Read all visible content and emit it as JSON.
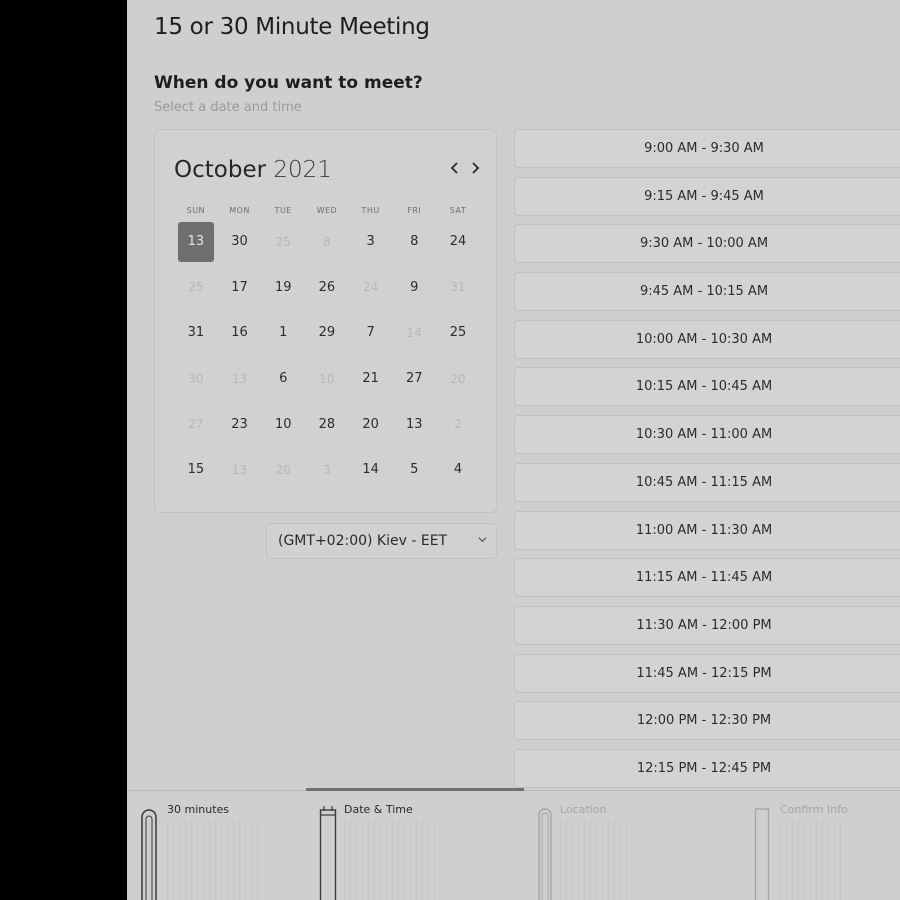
{
  "page": {
    "title": "15 or 30 Minute Meeting",
    "question": "When do you want to meet?",
    "hint": "Select a date and time"
  },
  "calendar": {
    "month": "October",
    "year": "2021",
    "prev_icon": "chevron-left-icon",
    "next_icon": "chevron-right-icon",
    "weekdays": [
      "SUN",
      "MON",
      "TUE",
      "WED",
      "THU",
      "FRI",
      "SAT"
    ],
    "weeks": [
      [
        {
          "d": "13",
          "state": "selected"
        },
        {
          "d": "30",
          "state": "available"
        },
        {
          "d": "25",
          "state": "disabled"
        },
        {
          "d": "8",
          "state": "disabled"
        },
        {
          "d": "3",
          "state": "available"
        },
        {
          "d": "8",
          "state": "available"
        },
        {
          "d": "24",
          "state": "available"
        }
      ],
      [
        {
          "d": "25",
          "state": "disabled"
        },
        {
          "d": "17",
          "state": "available"
        },
        {
          "d": "19",
          "state": "available"
        },
        {
          "d": "26",
          "state": "available"
        },
        {
          "d": "24",
          "state": "disabled"
        },
        {
          "d": "9",
          "state": "available"
        },
        {
          "d": "31",
          "state": "disabled"
        }
      ],
      [
        {
          "d": "31",
          "state": "available"
        },
        {
          "d": "16",
          "state": "available"
        },
        {
          "d": "1",
          "state": "available"
        },
        {
          "d": "29",
          "state": "available"
        },
        {
          "d": "7",
          "state": "available"
        },
        {
          "d": "14",
          "state": "disabled"
        },
        {
          "d": "25",
          "state": "available"
        }
      ],
      [
        {
          "d": "30",
          "state": "disabled"
        },
        {
          "d": "13",
          "state": "disabled"
        },
        {
          "d": "6",
          "state": "available"
        },
        {
          "d": "10",
          "state": "disabled"
        },
        {
          "d": "21",
          "state": "available"
        },
        {
          "d": "27",
          "state": "available"
        },
        {
          "d": "20",
          "state": "disabled"
        }
      ],
      [
        {
          "d": "27",
          "state": "disabled"
        },
        {
          "d": "23",
          "state": "available"
        },
        {
          "d": "10",
          "state": "available"
        },
        {
          "d": "28",
          "state": "available"
        },
        {
          "d": "20",
          "state": "available"
        },
        {
          "d": "13",
          "state": "available"
        },
        {
          "d": "2",
          "state": "disabled"
        }
      ],
      [
        {
          "d": "15",
          "state": "available"
        },
        {
          "d": "13",
          "state": "disabled"
        },
        {
          "d": "20",
          "state": "disabled"
        },
        {
          "d": "3",
          "state": "disabled"
        },
        {
          "d": "14",
          "state": "available"
        },
        {
          "d": "5",
          "state": "available"
        },
        {
          "d": "4",
          "state": "available"
        }
      ]
    ]
  },
  "timezone": {
    "value": "(GMT+02:00) Kiev - EET",
    "icon": "chevron-down-icon"
  },
  "time_slots": [
    "9:00 AM - 9:30 AM",
    "9:15 AM - 9:45 AM",
    "9:30 AM - 10:00 AM",
    "9:45 AM - 10:15 AM",
    "10:00 AM - 10:30 AM",
    "10:15 AM - 10:45 AM",
    "10:30 AM - 11:00 AM",
    "10:45 AM - 11:15 AM",
    "11:00 AM - 11:30 AM",
    "11:15 AM - 11:45 AM",
    "11:30 AM - 12:00 PM",
    "11:45 AM - 12:15 PM",
    "12:00 PM - 12:30 PM",
    "12:15 PM - 12:45 PM"
  ],
  "steps": [
    {
      "label": "30 minutes",
      "icon": "duration-icon",
      "active": true
    },
    {
      "label": "Date & Time",
      "icon": "calendar-icon",
      "active": true
    },
    {
      "label": "Location",
      "icon": "location-pin-icon",
      "active": false
    },
    {
      "label": "Confirm Info",
      "icon": "confirm-icon",
      "active": false
    }
  ],
  "colors": {
    "page_bg": "#cfcfcf",
    "selected_day": "#6f6f6f",
    "progress": "#707070"
  }
}
